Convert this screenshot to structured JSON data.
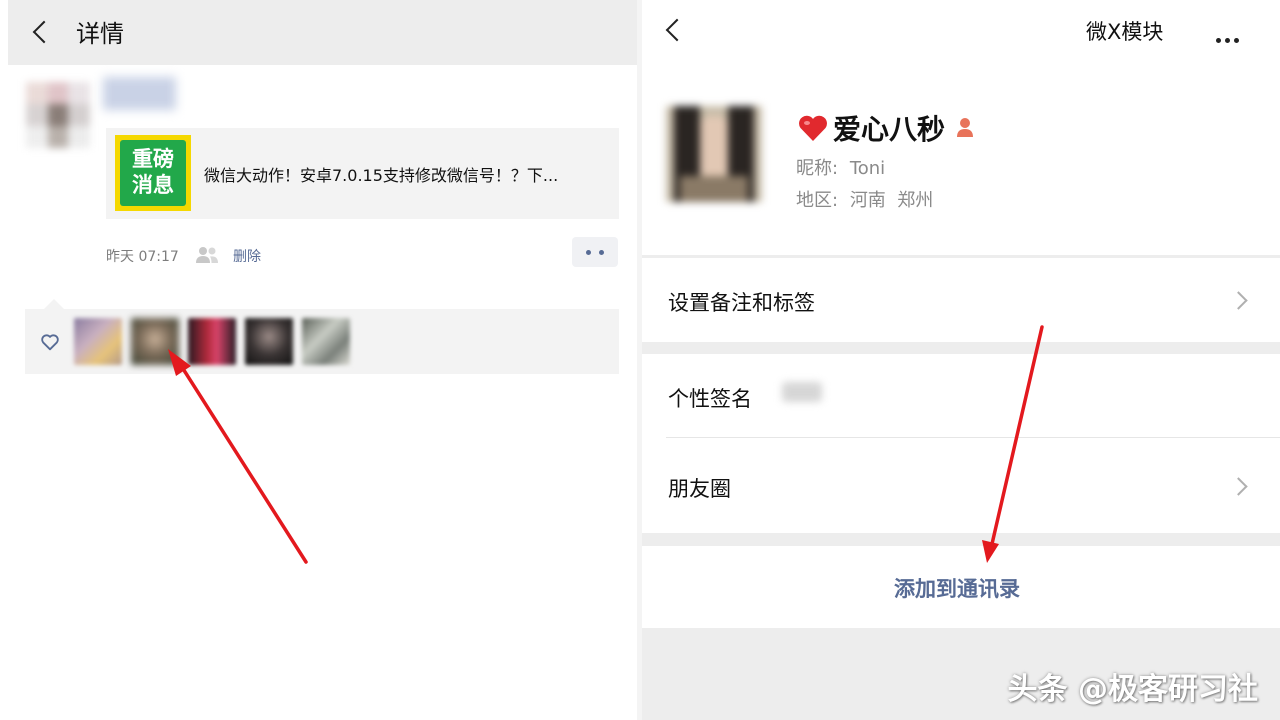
{
  "left": {
    "header": {
      "title": "详情"
    },
    "post": {
      "link_title": "微信大动作！安卓7.0.15支持修改微信号！？下...",
      "thumb_text": [
        "重磅",
        "消息"
      ],
      "time": "昨天 07:17",
      "delete_label": "删除"
    }
  },
  "right": {
    "header": {
      "module_label": "微X模块"
    },
    "profile": {
      "name": "爱心八秒",
      "nickname_label": "昵称:",
      "nickname": "Toni",
      "region_label": "地区:",
      "region": "河南  郑州"
    },
    "rows": [
      {
        "label": "设置备注和标签"
      },
      {
        "label": "个性签名"
      },
      {
        "label": "朋友圈"
      }
    ],
    "add_contact": "添加到通讯录"
  },
  "watermark": "头条 @极客研习社",
  "colors": {
    "link_blue": "#576b95",
    "arrow_red": "#e3191e",
    "bg_gray": "#ededed",
    "thumb_green": "#22a84a",
    "thumb_yellow": "#f5d800"
  }
}
